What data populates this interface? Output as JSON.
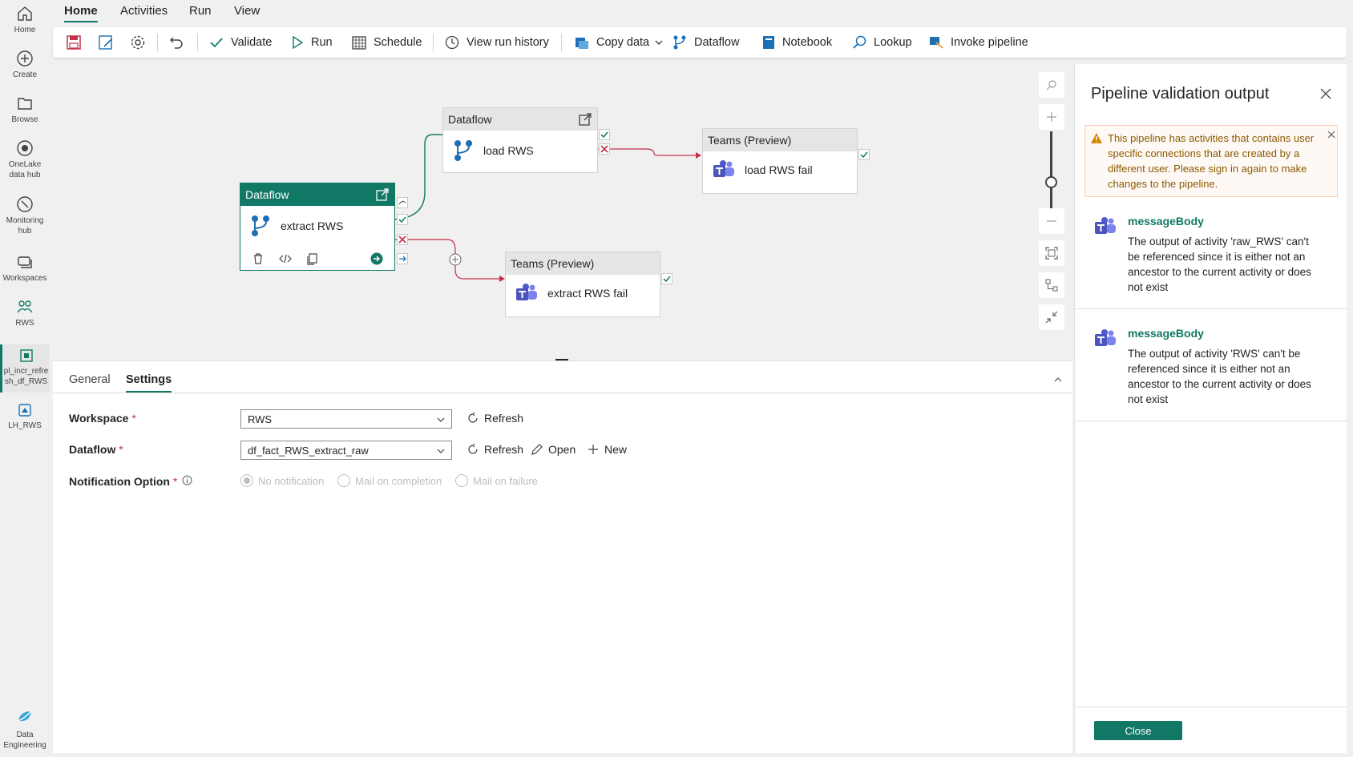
{
  "rail": [
    {
      "label": "Home",
      "icon": "home-icon"
    },
    {
      "label": "Create",
      "icon": "create-icon"
    },
    {
      "label": "Browse",
      "icon": "browse-icon"
    },
    {
      "label": "OneLake data hub",
      "line1": "OneLake",
      "line2": "data hub",
      "icon": "onelake-icon"
    },
    {
      "label": "Monitoring hub",
      "line1": "Monitoring",
      "line2": "hub",
      "icon": "monitoring-icon"
    },
    {
      "label": "Workspaces",
      "icon": "workspaces-icon"
    },
    {
      "label": "RWS",
      "icon": "rws-icon"
    },
    {
      "line1": "pl_incr_refre",
      "line2": "sh_df_RWS",
      "icon": "pipeline-icon"
    },
    {
      "label": "LH_RWS",
      "icon": "lakehouse-icon"
    },
    {
      "line1": "Data",
      "line2": "Engineering",
      "icon": "data-engineering-icon"
    }
  ],
  "menu": [
    "Home",
    "Activities",
    "Run",
    "View"
  ],
  "toolbar": {
    "validate": "Validate",
    "run": "Run",
    "schedule": "Schedule",
    "view_run_history": "View run history",
    "copy_data": "Copy data",
    "dataflow": "Dataflow",
    "notebook": "Notebook",
    "lookup": "Lookup",
    "invoke_pipeline": "Invoke pipeline"
  },
  "canvas": {
    "nodes": {
      "extract": {
        "type": "Dataflow",
        "name": "extract RWS"
      },
      "load": {
        "type": "Dataflow",
        "name": "load RWS"
      },
      "load_fail": {
        "type": "Teams (Preview)",
        "name": "load RWS fail"
      },
      "extract_fail": {
        "type": "Teams (Preview)",
        "name": "extract RWS fail"
      }
    }
  },
  "panel": {
    "tabs": [
      "General",
      "Settings"
    ],
    "workspace_label": "Workspace",
    "workspace_value": "RWS",
    "dataflow_label": "Dataflow",
    "dataflow_value": "df_fact_RWS_extract_raw",
    "notification_label": "Notification Option",
    "required_mark": "*",
    "refresh": "Refresh",
    "open": "Open",
    "new": "New",
    "radio": [
      "No notification",
      "Mail on completion",
      "Mail on failure"
    ]
  },
  "side": {
    "title": "Pipeline validation output",
    "warning": "This pipeline has activities that contains user specific connections that are created by a different user. Please sign in again to make changes to the pipeline.",
    "messages": [
      {
        "title": "messageBody",
        "text": "The output of activity 'raw_RWS' can't be referenced since it is either not an ancestor to the current activity or does not exist"
      },
      {
        "title": "messageBody",
        "text": "The output of activity 'RWS' can't be referenced since it is either not an ancestor to the current activity or does not exist"
      }
    ],
    "close": "Close"
  },
  "colors": {
    "accent": "#117865",
    "error": "#c4314b",
    "warning": "#fff9f5"
  }
}
